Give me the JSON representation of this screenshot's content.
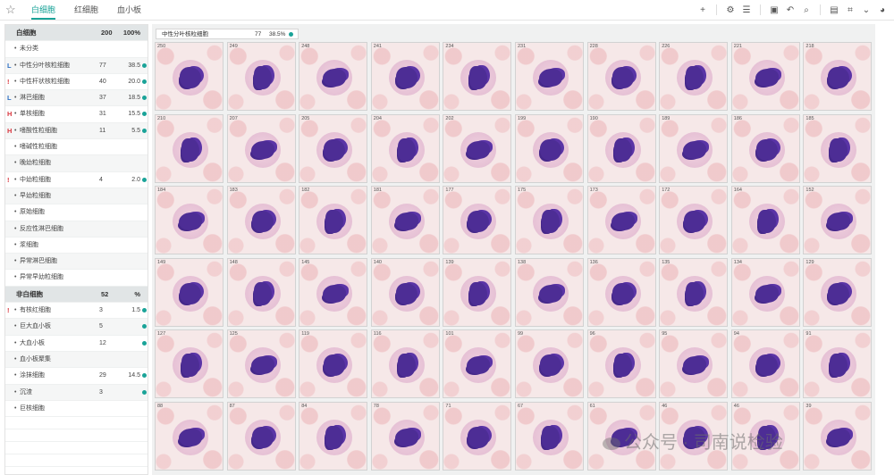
{
  "tabs": [
    {
      "label": "白细胞",
      "active": true
    },
    {
      "label": "红细胞",
      "active": false
    },
    {
      "label": "血小板",
      "active": false
    }
  ],
  "toolbar_icons": [
    "plus-icon",
    "settings-icon",
    "list-icon",
    "folder-icon",
    "undo-icon",
    "search-image-icon",
    "save-icon",
    "crop-icon",
    "chevron-down-icon",
    "palette-icon"
  ],
  "wbc": {
    "header": {
      "name": "白细胞",
      "count": "200",
      "percent": "100%"
    },
    "rows": [
      {
        "flag": "",
        "name": "未分类",
        "count": "",
        "percent": "",
        "dot": false
      },
      {
        "flag": "L",
        "name": "中性分叶核粒细胞",
        "count": "77",
        "percent": "38.5",
        "dot": true
      },
      {
        "flag": "!",
        "name": "中性杆状核粒细胞",
        "count": "40",
        "percent": "20.0",
        "dot": true
      },
      {
        "flag": "L",
        "name": "淋巴细胞",
        "count": "37",
        "percent": "18.5",
        "dot": true
      },
      {
        "flag": "H",
        "name": "单核细胞",
        "count": "31",
        "percent": "15.5",
        "dot": true
      },
      {
        "flag": "H",
        "name": "嗜酸性粒细胞",
        "count": "11",
        "percent": "5.5",
        "dot": true
      },
      {
        "flag": "",
        "name": "嗜碱性粒细胞",
        "count": "",
        "percent": "",
        "dot": false
      },
      {
        "flag": "",
        "name": "晚幼粒细胞",
        "count": "",
        "percent": "",
        "dot": false
      },
      {
        "flag": "!",
        "name": "中幼粒细胞",
        "count": "4",
        "percent": "2.0",
        "dot": true
      },
      {
        "flag": "",
        "name": "早幼粒细胞",
        "count": "",
        "percent": "",
        "dot": false
      },
      {
        "flag": "",
        "name": "原始细胞",
        "count": "",
        "percent": "",
        "dot": false
      },
      {
        "flag": "",
        "name": "反应性淋巴细胞",
        "count": "",
        "percent": "",
        "dot": false
      },
      {
        "flag": "",
        "name": "浆细胞",
        "count": "",
        "percent": "",
        "dot": false
      },
      {
        "flag": "",
        "name": "异常淋巴细胞",
        "count": "",
        "percent": "",
        "dot": false
      },
      {
        "flag": "",
        "name": "异常早幼粒细胞",
        "count": "",
        "percent": "",
        "dot": false
      }
    ]
  },
  "nonwbc": {
    "header": {
      "name": "非白细胞",
      "count": "52",
      "percent": "%"
    },
    "rows": [
      {
        "flag": "!",
        "name": "有核红细胞",
        "count": "3",
        "percent": "1.5",
        "dot": true
      },
      {
        "flag": "",
        "name": "巨大血小板",
        "count": "5",
        "percent": "",
        "dot": true
      },
      {
        "flag": "",
        "name": "大血小板",
        "count": "12",
        "percent": "",
        "dot": true
      },
      {
        "flag": "",
        "name": "血小板聚集",
        "count": "",
        "percent": "",
        "dot": false
      },
      {
        "flag": "",
        "name": "涂抹细胞",
        "count": "29",
        "percent": "14.5",
        "dot": true
      },
      {
        "flag": "",
        "name": "沉渣",
        "count": "3",
        "percent": "",
        "dot": true
      },
      {
        "flag": "",
        "name": "巨核细胞",
        "count": "",
        "percent": "",
        "dot": false
      }
    ]
  },
  "selection": {
    "name": "中性分叶核粒细胞",
    "count": "77",
    "percent": "38.5%"
  },
  "cells": [
    "250",
    "249",
    "248",
    "241",
    "234",
    "231",
    "228",
    "226",
    "221",
    "218",
    "210",
    "207",
    "205",
    "204",
    "202",
    "199",
    "190",
    "189",
    "186",
    "185",
    "184",
    "183",
    "182",
    "181",
    "177",
    "175",
    "173",
    "172",
    "164",
    "152",
    "149",
    "148",
    "145",
    "140",
    "139",
    "138",
    "136",
    "135",
    "134",
    "129",
    "127",
    "125",
    "119",
    "116",
    "101",
    "99",
    "96",
    "95",
    "94",
    "91",
    "88",
    "87",
    "84",
    "78",
    "71",
    "67",
    "61",
    "46",
    "46",
    "39"
  ],
  "watermark": "公众号 · 司南说检验"
}
